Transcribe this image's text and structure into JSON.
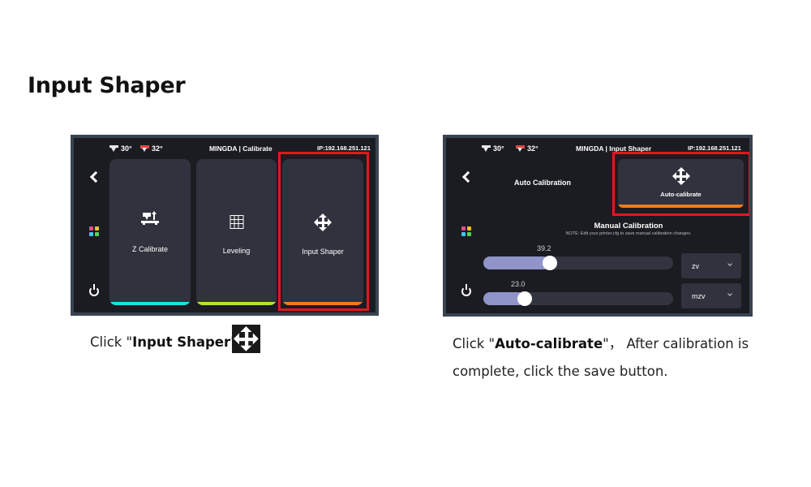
{
  "page": {
    "title": "Input Shaper"
  },
  "screen1": {
    "nozzle_temp": "30°",
    "bed_temp": "32°",
    "title": "MINGDA | Calibrate",
    "ip": "IP:192.168.251.121",
    "cards": [
      {
        "label": "Z Calibrate",
        "accent": "#19e3e8"
      },
      {
        "label": "Leveling",
        "accent": "#b6e236"
      },
      {
        "label": "Input Shaper",
        "accent": "#f07a1c"
      }
    ]
  },
  "screen2": {
    "nozzle_temp": "30°",
    "bed_temp": "32°",
    "title": "MINGDA | Input Shaper",
    "ip": "IP:192.168.251.121",
    "auto_label": "Auto Calibration",
    "auto_button_label": "Auto-calibrate",
    "manual_title": "Manual Calibration",
    "manual_note": "NOTE: Edit your printer.cfg to save manual calibration changes.",
    "sliders": [
      {
        "value": "39.2",
        "fraction": 0.31,
        "select": "zv"
      },
      {
        "value": "23.0",
        "fraction": 0.18,
        "select": "mzv"
      }
    ]
  },
  "captions": {
    "step1_prefix": "Click \"",
    "step1_bold": "Input Shaper",
    "step1_suffix": "\"",
    "step2_prefix": "Click \"",
    "step2_bold": "Auto-calibrate",
    "step2_suffix": "\"，  After calibration is",
    "step2_line2": "complete, click the save button."
  },
  "colors": {
    "highlight": "#e0181c",
    "screen_bg": "#1b1c21",
    "card_bg": "#30323d"
  }
}
